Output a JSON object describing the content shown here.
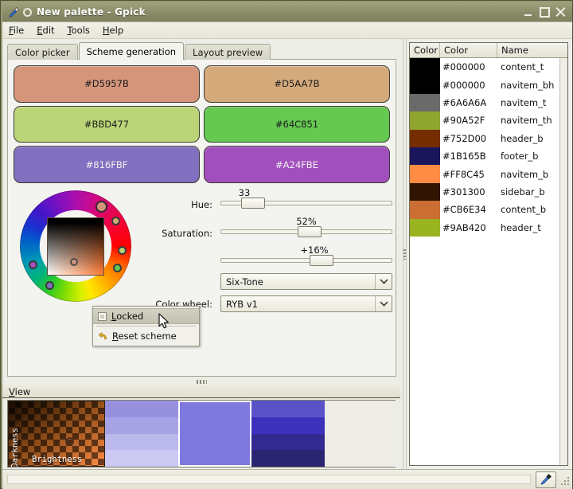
{
  "window": {
    "title": "New palette - Gpick",
    "icon": "eyedropper-icon",
    "buttons": {
      "minimize": "–",
      "maximize": "▣",
      "close": "✕"
    }
  },
  "menubar": {
    "items": [
      {
        "label": "File",
        "mnemonic": "F"
      },
      {
        "label": "Edit",
        "mnemonic": "E"
      },
      {
        "label": "Tools",
        "mnemonic": "T"
      },
      {
        "label": "Help",
        "mnemonic": "H"
      }
    ]
  },
  "tabs": [
    {
      "label": "Color picker",
      "active": false
    },
    {
      "label": "Scheme generation",
      "active": true
    },
    {
      "label": "Layout preview",
      "active": false
    }
  ],
  "scheme": {
    "swatches": [
      {
        "hex": "#D5957B",
        "label": "#D5957B",
        "text_color": "#1c1c1c"
      },
      {
        "hex": "#D5AA7B",
        "label": "#D5AA7B",
        "text_color": "#1c1c1c"
      },
      {
        "hex": "#BBD477",
        "label": "#BBD477",
        "text_color": "#1c1c1c"
      },
      {
        "hex": "#64C851",
        "label": "#64C851",
        "text_color": "#1c1c1c"
      },
      {
        "hex": "#816FBF",
        "label": "#816FBF",
        "text_color": "#f2f2f2"
      },
      {
        "hex": "#A24FBE",
        "label": "#A24FBE",
        "text_color": "#f2f2f2"
      }
    ],
    "sliders": [
      {
        "name": "hue",
        "label": "Hue:",
        "value": "33",
        "pos_pct": 14
      },
      {
        "name": "saturation",
        "label": "Saturation:",
        "value": "52%",
        "pos_pct": 52
      },
      {
        "name": "lightness",
        "label": "",
        "value": "+16%",
        "pos_pct": 60
      }
    ],
    "scheme_type": {
      "label": "",
      "value": "Six-Tone"
    },
    "color_wheel": {
      "label": "Color wheel:",
      "value": "RYB v1"
    },
    "wheel_markers": [
      {
        "color": "#D5957B",
        "angle_deg": 33,
        "size": "big"
      },
      {
        "color": "#D5AA7B",
        "angle_deg": 58,
        "size": "small"
      },
      {
        "color": "#BBD477",
        "angle_deg": 95,
        "size": "small"
      },
      {
        "color": "#64C851",
        "angle_deg": 118,
        "size": "small"
      },
      {
        "color": "#816FBF",
        "angle_deg": 213,
        "size": "small"
      },
      {
        "color": "#A24FBE",
        "angle_deg": 246,
        "size": "small"
      }
    ],
    "sv_marker": {
      "color": "#D5957B"
    }
  },
  "context_menu": {
    "items": [
      {
        "label": "Locked",
        "mnemonic": "L",
        "type": "checkbox",
        "checked": false,
        "hovered": true
      },
      {
        "label": "Reset scheme",
        "mnemonic": "R",
        "type": "action",
        "icon": "undo-icon",
        "hovered": false
      }
    ]
  },
  "view_panel": {
    "title": "View",
    "mnemonic": "V",
    "axis_vertical": "Darkness",
    "axis_horizontal": "Brightness",
    "checker_base": "#FF8C45",
    "left_strip": [
      "#9690DF",
      "#A7A2E4",
      "#BBB8EC",
      "#CBC9F2"
    ],
    "center_block": "#7F78DE",
    "right_strip": [
      "#5A52C8",
      "#3C31BC",
      "#33298F",
      "#2B2470"
    ]
  },
  "palette_list": {
    "columns": [
      "Color",
      "Color",
      "Name"
    ],
    "rows": [
      {
        "hex": "#000000",
        "name": "content_t"
      },
      {
        "hex": "#000000",
        "name": "navitem_bh"
      },
      {
        "hex": "#6A6A6A",
        "name": "navitem_t"
      },
      {
        "hex": "#90A52F",
        "name": "navitem_th"
      },
      {
        "hex": "#752D00",
        "name": "header_b"
      },
      {
        "hex": "#1B165B",
        "name": "footer_b"
      },
      {
        "hex": "#FF8C45",
        "name": "navitem_b"
      },
      {
        "hex": "#301300",
        "name": "sidebar_b"
      },
      {
        "hex": "#CB6E34",
        "name": "content_b"
      },
      {
        "hex": "#9AB420",
        "name": "header_t"
      }
    ]
  },
  "statusbar": {
    "pick_button": "eyedropper-icon",
    "resize_grip": "resize-grip-icon"
  },
  "colors": {
    "window_bg": "#8D8F6B",
    "client_bg": "#EEEEEA",
    "panel_bg": "#F3F3EF",
    "border": "#A9A996"
  }
}
